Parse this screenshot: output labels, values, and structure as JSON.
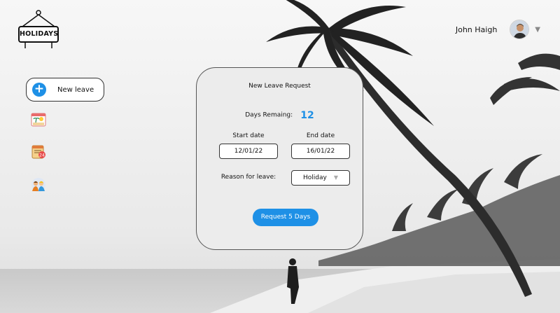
{
  "header": {
    "logo_text": "HOLIDAYS",
    "user_name": "John Haigh"
  },
  "sidebar": {
    "new_leave_label": "New leave",
    "icons": [
      "beach-calendar-icon",
      "calendar-scroll-icon",
      "team-people-icon"
    ]
  },
  "card": {
    "title": "New Leave Request",
    "days_remaining_label": "Days Remaing:",
    "days_remaining_value": "12",
    "start_label": "Start date",
    "start_value": "12/01/22",
    "end_label": "End date",
    "end_value": "16/01/22",
    "reason_label": "Reason for leave:",
    "reason_value": "Holiday",
    "submit_label": "Request 5 Days"
  },
  "colors": {
    "accent": "#1e90e6"
  }
}
